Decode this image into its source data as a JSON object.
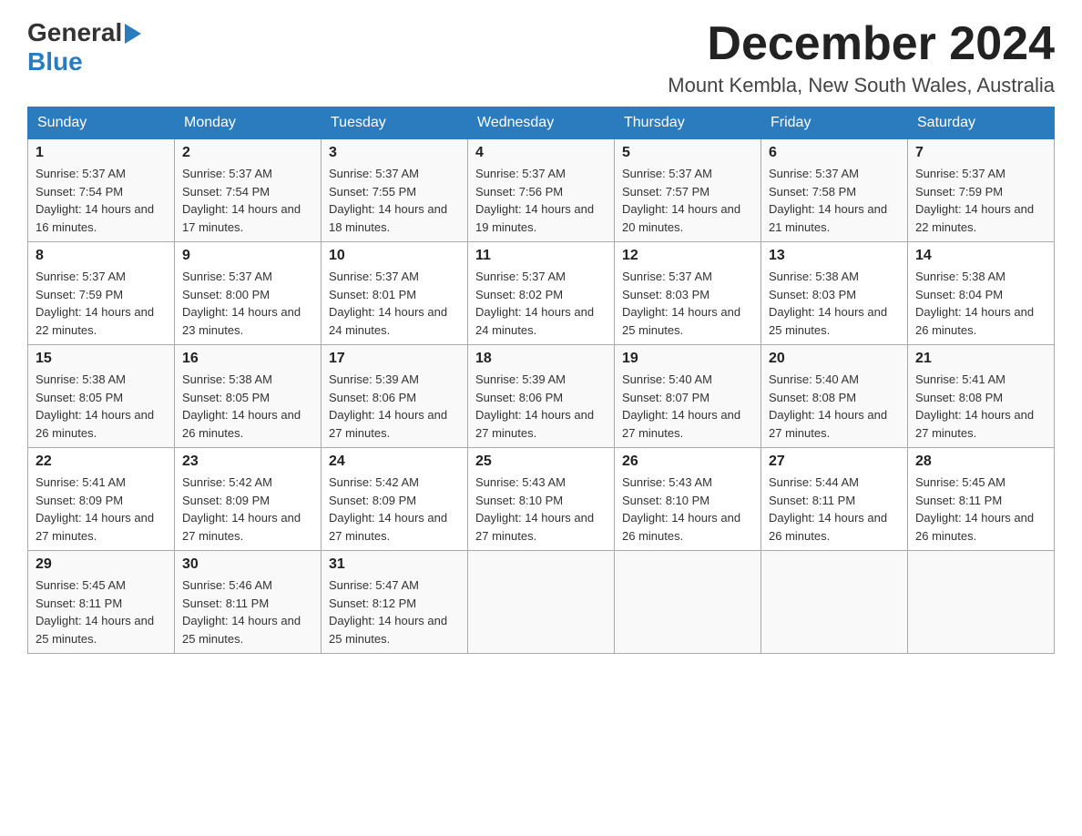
{
  "header": {
    "logo": {
      "general": "General",
      "blue": "Blue",
      "arrow": "▶"
    },
    "title": "December 2024",
    "location": "Mount Kembla, New South Wales, Australia"
  },
  "calendar": {
    "days_of_week": [
      "Sunday",
      "Monday",
      "Tuesday",
      "Wednesday",
      "Thursday",
      "Friday",
      "Saturday"
    ],
    "weeks": [
      [
        {
          "day": "1",
          "sunrise": "Sunrise: 5:37 AM",
          "sunset": "Sunset: 7:54 PM",
          "daylight": "Daylight: 14 hours and 16 minutes."
        },
        {
          "day": "2",
          "sunrise": "Sunrise: 5:37 AM",
          "sunset": "Sunset: 7:54 PM",
          "daylight": "Daylight: 14 hours and 17 minutes."
        },
        {
          "day": "3",
          "sunrise": "Sunrise: 5:37 AM",
          "sunset": "Sunset: 7:55 PM",
          "daylight": "Daylight: 14 hours and 18 minutes."
        },
        {
          "day": "4",
          "sunrise": "Sunrise: 5:37 AM",
          "sunset": "Sunset: 7:56 PM",
          "daylight": "Daylight: 14 hours and 19 minutes."
        },
        {
          "day": "5",
          "sunrise": "Sunrise: 5:37 AM",
          "sunset": "Sunset: 7:57 PM",
          "daylight": "Daylight: 14 hours and 20 minutes."
        },
        {
          "day": "6",
          "sunrise": "Sunrise: 5:37 AM",
          "sunset": "Sunset: 7:58 PM",
          "daylight": "Daylight: 14 hours and 21 minutes."
        },
        {
          "day": "7",
          "sunrise": "Sunrise: 5:37 AM",
          "sunset": "Sunset: 7:59 PM",
          "daylight": "Daylight: 14 hours and 22 minutes."
        }
      ],
      [
        {
          "day": "8",
          "sunrise": "Sunrise: 5:37 AM",
          "sunset": "Sunset: 7:59 PM",
          "daylight": "Daylight: 14 hours and 22 minutes."
        },
        {
          "day": "9",
          "sunrise": "Sunrise: 5:37 AM",
          "sunset": "Sunset: 8:00 PM",
          "daylight": "Daylight: 14 hours and 23 minutes."
        },
        {
          "day": "10",
          "sunrise": "Sunrise: 5:37 AM",
          "sunset": "Sunset: 8:01 PM",
          "daylight": "Daylight: 14 hours and 24 minutes."
        },
        {
          "day": "11",
          "sunrise": "Sunrise: 5:37 AM",
          "sunset": "Sunset: 8:02 PM",
          "daylight": "Daylight: 14 hours and 24 minutes."
        },
        {
          "day": "12",
          "sunrise": "Sunrise: 5:37 AM",
          "sunset": "Sunset: 8:03 PM",
          "daylight": "Daylight: 14 hours and 25 minutes."
        },
        {
          "day": "13",
          "sunrise": "Sunrise: 5:38 AM",
          "sunset": "Sunset: 8:03 PM",
          "daylight": "Daylight: 14 hours and 25 minutes."
        },
        {
          "day": "14",
          "sunrise": "Sunrise: 5:38 AM",
          "sunset": "Sunset: 8:04 PM",
          "daylight": "Daylight: 14 hours and 26 minutes."
        }
      ],
      [
        {
          "day": "15",
          "sunrise": "Sunrise: 5:38 AM",
          "sunset": "Sunset: 8:05 PM",
          "daylight": "Daylight: 14 hours and 26 minutes."
        },
        {
          "day": "16",
          "sunrise": "Sunrise: 5:38 AM",
          "sunset": "Sunset: 8:05 PM",
          "daylight": "Daylight: 14 hours and 26 minutes."
        },
        {
          "day": "17",
          "sunrise": "Sunrise: 5:39 AM",
          "sunset": "Sunset: 8:06 PM",
          "daylight": "Daylight: 14 hours and 27 minutes."
        },
        {
          "day": "18",
          "sunrise": "Sunrise: 5:39 AM",
          "sunset": "Sunset: 8:06 PM",
          "daylight": "Daylight: 14 hours and 27 minutes."
        },
        {
          "day": "19",
          "sunrise": "Sunrise: 5:40 AM",
          "sunset": "Sunset: 8:07 PM",
          "daylight": "Daylight: 14 hours and 27 minutes."
        },
        {
          "day": "20",
          "sunrise": "Sunrise: 5:40 AM",
          "sunset": "Sunset: 8:08 PM",
          "daylight": "Daylight: 14 hours and 27 minutes."
        },
        {
          "day": "21",
          "sunrise": "Sunrise: 5:41 AM",
          "sunset": "Sunset: 8:08 PM",
          "daylight": "Daylight: 14 hours and 27 minutes."
        }
      ],
      [
        {
          "day": "22",
          "sunrise": "Sunrise: 5:41 AM",
          "sunset": "Sunset: 8:09 PM",
          "daylight": "Daylight: 14 hours and 27 minutes."
        },
        {
          "day": "23",
          "sunrise": "Sunrise: 5:42 AM",
          "sunset": "Sunset: 8:09 PM",
          "daylight": "Daylight: 14 hours and 27 minutes."
        },
        {
          "day": "24",
          "sunrise": "Sunrise: 5:42 AM",
          "sunset": "Sunset: 8:09 PM",
          "daylight": "Daylight: 14 hours and 27 minutes."
        },
        {
          "day": "25",
          "sunrise": "Sunrise: 5:43 AM",
          "sunset": "Sunset: 8:10 PM",
          "daylight": "Daylight: 14 hours and 27 minutes."
        },
        {
          "day": "26",
          "sunrise": "Sunrise: 5:43 AM",
          "sunset": "Sunset: 8:10 PM",
          "daylight": "Daylight: 14 hours and 26 minutes."
        },
        {
          "day": "27",
          "sunrise": "Sunrise: 5:44 AM",
          "sunset": "Sunset: 8:11 PM",
          "daylight": "Daylight: 14 hours and 26 minutes."
        },
        {
          "day": "28",
          "sunrise": "Sunrise: 5:45 AM",
          "sunset": "Sunset: 8:11 PM",
          "daylight": "Daylight: 14 hours and 26 minutes."
        }
      ],
      [
        {
          "day": "29",
          "sunrise": "Sunrise: 5:45 AM",
          "sunset": "Sunset: 8:11 PM",
          "daylight": "Daylight: 14 hours and 25 minutes."
        },
        {
          "day": "30",
          "sunrise": "Sunrise: 5:46 AM",
          "sunset": "Sunset: 8:11 PM",
          "daylight": "Daylight: 14 hours and 25 minutes."
        },
        {
          "day": "31",
          "sunrise": "Sunrise: 5:47 AM",
          "sunset": "Sunset: 8:12 PM",
          "daylight": "Daylight: 14 hours and 25 minutes."
        },
        null,
        null,
        null,
        null
      ]
    ]
  }
}
